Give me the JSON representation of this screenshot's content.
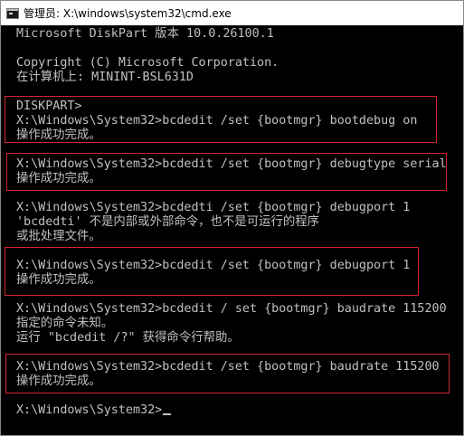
{
  "window": {
    "title": "管理员: X:\\windows\\system32\\cmd.exe",
    "icon": "cmd-console-icon"
  },
  "console": {
    "lines": [
      "Microsoft DiskPart 版本 10.0.26100.1",
      "",
      "Copyright (C) Microsoft Corporation.",
      "在计算机上: MININT-BSL631D",
      "",
      "DISKPART>",
      "X:\\Windows\\System32>bcdedit /set {bootmgr} bootdebug on",
      "操作成功完成。",
      "",
      "X:\\Windows\\System32>bcdedit /set {bootmgr} debugtype serial",
      "操作成功完成。",
      "",
      "X:\\Windows\\System32>bcdedti /set {bootmgr} debugport 1",
      "'bcdedti' 不是内部或外部命令，也不是可运行的程序",
      "或批处理文件。",
      "",
      "X:\\Windows\\System32>bcdedit /set {bootmgr} debugport 1",
      "操作成功完成。",
      "",
      "X:\\Windows\\System32>bcdedit / set {bootmgr} baudrate 115200",
      "指定的命令未知。",
      "运行 \"bcdedit /?\" 获得命令行帮助。",
      "",
      "X:\\Windows\\System32>bcdedit /set {bootmgr} baudrate 115200",
      "操作成功完成。",
      "",
      "X:\\Windows\\System32>"
    ]
  },
  "colors": {
    "console_background": "#000000",
    "console_text": "#c0c0c0",
    "highlight_border": "#d2282e"
  }
}
